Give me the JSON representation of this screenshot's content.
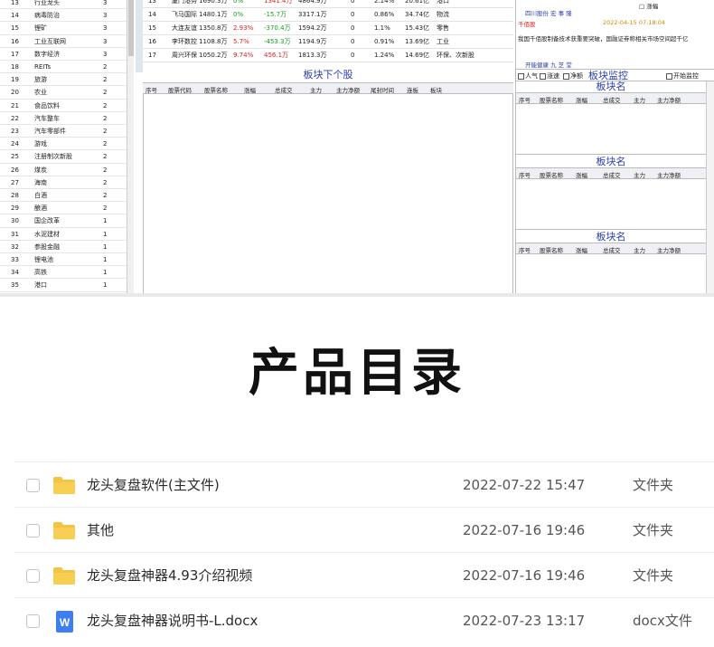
{
  "left_list": {
    "rows": [
      {
        "no": "13",
        "name": "行业龙头",
        "count": "3"
      },
      {
        "no": "14",
        "name": "病毒防治",
        "count": "3"
      },
      {
        "no": "15",
        "name": "锂矿",
        "count": "3"
      },
      {
        "no": "16",
        "name": "工业互联网",
        "count": "3"
      },
      {
        "no": "17",
        "name": "数字经济",
        "count": "3"
      },
      {
        "no": "18",
        "name": "REITs",
        "count": "2"
      },
      {
        "no": "19",
        "name": "旅游",
        "count": "2"
      },
      {
        "no": "20",
        "name": "农业",
        "count": "2"
      },
      {
        "no": "21",
        "name": "食品饮料",
        "count": "2"
      },
      {
        "no": "22",
        "name": "汽车整车",
        "count": "2"
      },
      {
        "no": "23",
        "name": "汽车零部件",
        "count": "2"
      },
      {
        "no": "24",
        "name": "游戏",
        "count": "2"
      },
      {
        "no": "25",
        "name": "注册制次新股",
        "count": "2"
      },
      {
        "no": "26",
        "name": "煤炭",
        "count": "2"
      },
      {
        "no": "27",
        "name": "海南",
        "count": "2"
      },
      {
        "no": "28",
        "name": "白酒",
        "count": "2"
      },
      {
        "no": "29",
        "name": "酿酒",
        "count": "2"
      },
      {
        "no": "30",
        "name": "国企改革",
        "count": "1"
      },
      {
        "no": "31",
        "name": "水泥建材",
        "count": "1"
      },
      {
        "no": "32",
        "name": "参股金融",
        "count": "1"
      },
      {
        "no": "33",
        "name": "锂电池",
        "count": "1"
      },
      {
        "no": "34",
        "name": "高铁",
        "count": "1"
      },
      {
        "no": "35",
        "name": "港口",
        "count": "1"
      }
    ]
  },
  "stock_table": {
    "rows": [
      {
        "no": "13",
        "name": "厦门港务",
        "vol": "1690.3万",
        "pct": "0%",
        "pct_color": "green",
        "net": "1341.4万",
        "net_color": "red",
        "tot": "4864.9万",
        "z": "0",
        "rate": "2.14%",
        "cap": "20.61亿",
        "ind": "港口"
      },
      {
        "no": "14",
        "name": "飞马国际",
        "vol": "1480.1万",
        "pct": "0%",
        "pct_color": "green",
        "net": "-15.7万",
        "net_color": "green",
        "tot": "3317.1万",
        "z": "0",
        "rate": "0.86%",
        "cap": "34.74亿",
        "ind": "物流"
      },
      {
        "no": "15",
        "name": "大连友谊",
        "vol": "1350.8万",
        "pct": "2.93%",
        "pct_color": "red",
        "net": "-370.4万",
        "net_color": "green",
        "tot": "1594.2万",
        "z": "0",
        "rate": "1.1%",
        "cap": "15.43亿",
        "ind": "零售"
      },
      {
        "no": "16",
        "name": "李环数控",
        "vol": "1108.8万",
        "pct": "5.7%",
        "pct_color": "red",
        "net": "-453.3万",
        "net_color": "green",
        "tot": "1194.9万",
        "z": "0",
        "rate": "0.91%",
        "cap": "13.69亿",
        "ind": "工业"
      },
      {
        "no": "17",
        "name": "周兴环保",
        "vol": "1050.2万",
        "pct": "9.74%",
        "pct_color": "red",
        "net": "456.1万",
        "net_color": "red",
        "tot": "1813.3万",
        "z": "0",
        "rate": "1.24%",
        "cap": "14.69亿",
        "ind": "环保、次新股"
      }
    ]
  },
  "sub_panel": {
    "title": "板块下个股",
    "headers": [
      "序号",
      "股票代码",
      "股票名称",
      "涨幅",
      "总成交",
      "主力",
      "主力净额",
      "尾封时间",
      "连板",
      "板块"
    ]
  },
  "news": {
    "lines": [
      "□ 涨幅",
      "四川股份    宏 事 隆",
      "千佰股",
      "2022-04-15 07:18:04",
      "我国千佰股制备技术获重要突破，国融证券称相关市场空间超千亿",
      "开能健康    九 芝 堂"
    ]
  },
  "monitor": {
    "title": "板块监控",
    "options": [
      "人气",
      "涨速",
      "净额"
    ],
    "option_right": "开始监控",
    "blocks": [
      {
        "name": "板块名"
      },
      {
        "name": "板块名"
      },
      {
        "name": "板块名"
      }
    ],
    "block_headers": [
      "序号",
      "股票名称",
      "涨幅",
      "总成交",
      "主力",
      "主力净额"
    ]
  },
  "catalog": {
    "title": "产品目录"
  },
  "files": [
    {
      "name": "龙头复盘软件(主文件)",
      "date": "2022-07-22 15:47",
      "type": "文件夹",
      "icon": "folder-icon"
    },
    {
      "name": "其他",
      "date": "2022-07-16 19:46",
      "type": "文件夹",
      "icon": "folder-icon"
    },
    {
      "name": "龙头复盘神器4.93介绍视频",
      "date": "2022-07-16 19:46",
      "type": "文件夹",
      "icon": "folder-icon"
    },
    {
      "name": "龙头复盘神器说明书-L.docx",
      "date": "2022-07-23 13:17",
      "type": "docx文件",
      "icon": "word-doc-icon"
    }
  ],
  "colors": {
    "folder": "#f5c342",
    "word": "#3d7ef2",
    "accent_blue": "#2a3fb0",
    "up_red": "#e02020",
    "down_green": "#13a01c"
  }
}
